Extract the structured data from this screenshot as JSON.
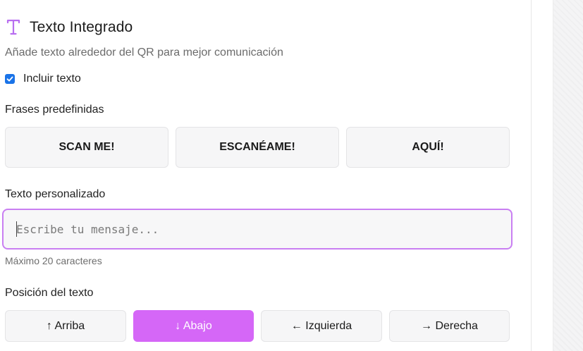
{
  "header": {
    "title": "Texto Integrado",
    "icon": "text-type-icon",
    "accent_color": "#b86ef0",
    "subtitle": "Añade texto alrededor del QR para mejor comunicación"
  },
  "include_text": {
    "label": "Incluir texto",
    "checked": true
  },
  "presets": {
    "label": "Frases predefinidas",
    "items": [
      "SCAN ME!",
      "ESCANÉAME!",
      "AQUÍ!"
    ]
  },
  "custom_text": {
    "label": "Texto personalizado",
    "value": "",
    "placeholder": "Escribe tu mensaje...",
    "hint": "Máximo 20 caracteres"
  },
  "position": {
    "label": "Posición del texto",
    "options": [
      "↑ Arriba",
      "↓ Abajo",
      "← Izquierda",
      "→ Derecha"
    ],
    "selected": "↓ Abajo",
    "active_color": "#d567f7"
  }
}
